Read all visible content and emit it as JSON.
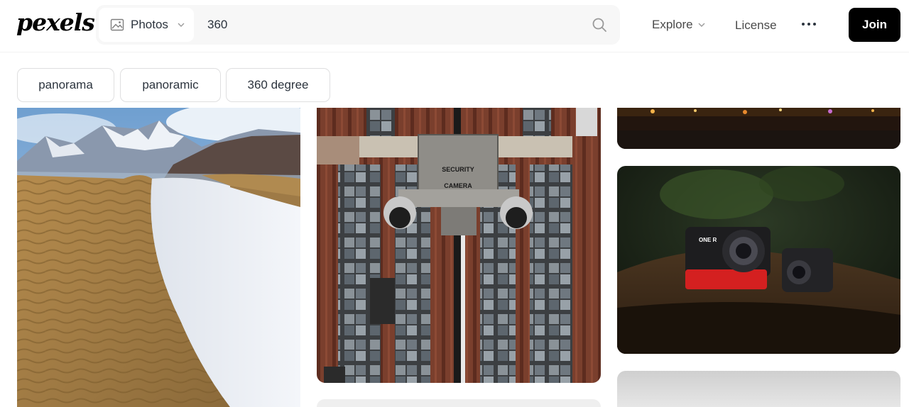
{
  "header": {
    "logo": "pexels",
    "search": {
      "type_label": "Photos",
      "query": "360"
    },
    "nav": {
      "explore": "Explore",
      "license": "License",
      "join": "Join"
    }
  },
  "chips": [
    {
      "label": "panorama"
    },
    {
      "label": "panoramic"
    },
    {
      "label": "360 degree"
    }
  ],
  "photos": {
    "security_camera": {
      "sign_line1": "SECURITY",
      "sign_line2": "CAMERA"
    },
    "action_camera": {
      "brand": "ONE R"
    }
  }
}
